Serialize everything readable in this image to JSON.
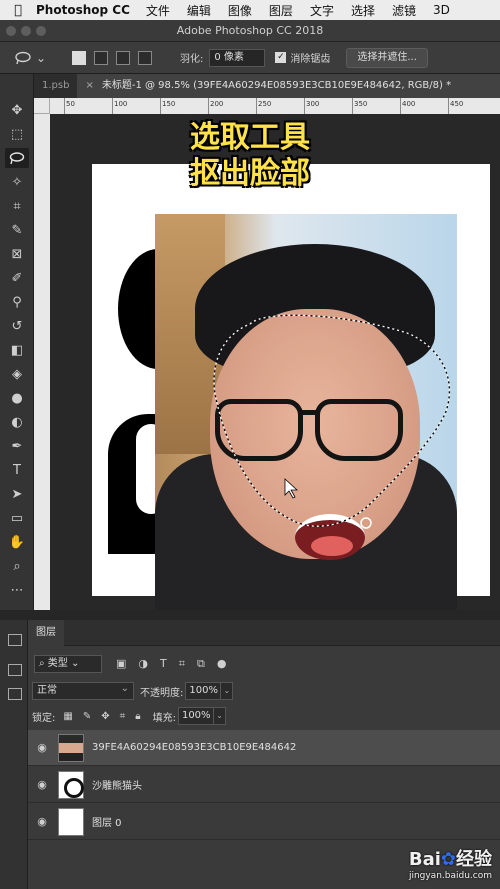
{
  "menubar": {
    "app": "Photoshop CC",
    "items": [
      "文件",
      "编辑",
      "图像",
      "图层",
      "文字",
      "选择",
      "滤镜",
      "3D"
    ]
  },
  "window": {
    "title": "Adobe Photoshop CC 2018"
  },
  "options": {
    "feather_label": "羽化:",
    "feather_value": "0 像素",
    "antialias_label": "消除锯齿",
    "antialias_checked": true,
    "mask_button": "选择并遮住..."
  },
  "tabs": [
    {
      "label": "1.psb"
    },
    {
      "label": "未标题-1 @ 98.5% (39FE4A60294E08593E3CB10E9E484642, RGB/8) *"
    }
  ],
  "ruler": {
    "ticks": [
      "50",
      "100",
      "150",
      "200",
      "250",
      "300",
      "350",
      "400",
      "450"
    ]
  },
  "canvas": {
    "overlay_title_line1": "选取工具",
    "overlay_title_line2": "抠出脸部"
  },
  "layers_panel": {
    "tab_label": "图层",
    "filter_label": "类型",
    "blend_mode": "正常",
    "opacity_label": "不透明度:",
    "opacity_value": "100%",
    "lock_label": "锁定:",
    "fill_label": "填充:",
    "fill_value": "100%",
    "layers": [
      {
        "name": "39FE4A60294E08593E3CB10E9E484642",
        "selected": true,
        "thumb": "photo"
      },
      {
        "name": "沙雕熊猫头",
        "selected": false,
        "thumb": "panda"
      },
      {
        "name": "图层 0",
        "selected": false,
        "thumb": "white"
      }
    ]
  },
  "watermark": {
    "brand": "Bai",
    "brand2": "经验",
    "url": "jingyan.baidu.com"
  },
  "colors": {
    "accent_yellow": "#ffe14a",
    "panel_bg": "#3a3a3a",
    "selected_layer": "#4d4d4d"
  },
  "icons": {
    "tools": [
      "move-icon",
      "marquee-icon",
      "lasso-icon",
      "magic-wand-icon",
      "crop-icon",
      "eyedropper-icon",
      "frame-icon",
      "brush-icon",
      "stamp-icon",
      "history-brush-icon",
      "eraser-icon",
      "paint-bucket-icon",
      "blur-icon",
      "dodge-icon",
      "pen-icon",
      "type-icon",
      "path-select-icon",
      "rectangle-icon",
      "hand-icon",
      "zoom-icon",
      "more-icon"
    ]
  }
}
